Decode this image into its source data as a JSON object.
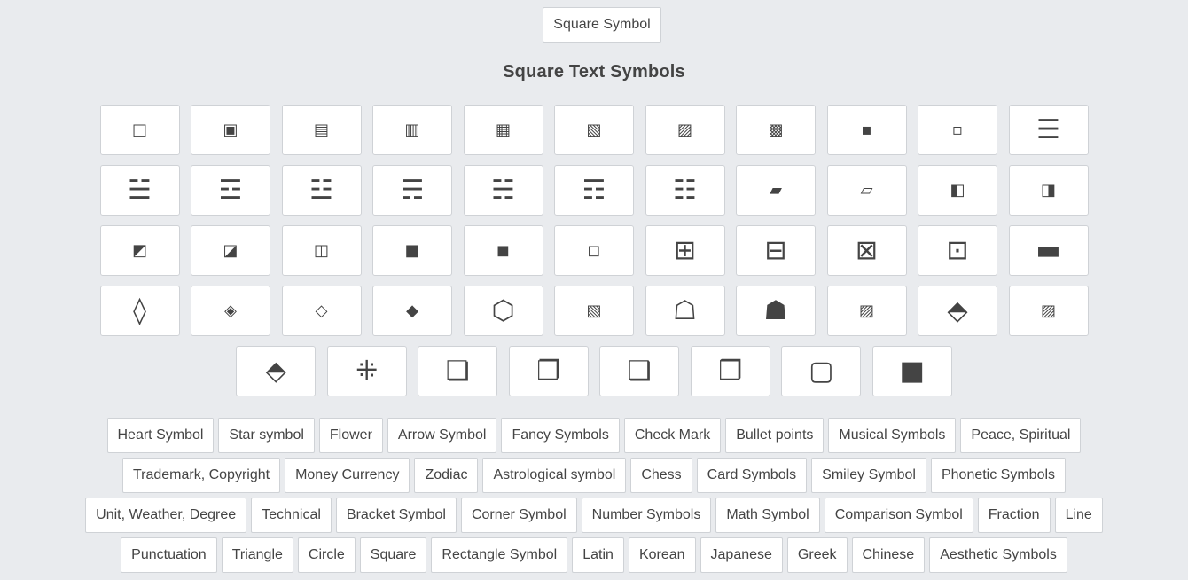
{
  "top_button": "Square Symbol",
  "heading": "Square Text Symbols",
  "symbol_rows": [
    [
      "□",
      "▣",
      "▤",
      "▥",
      "▦",
      "▧",
      "▨",
      "▩",
      "▪",
      "▫",
      "☰"
    ],
    [
      "☱",
      "☲",
      "☳",
      "☴",
      "☵",
      "☶",
      "☷",
      "▰",
      "▱",
      "◧",
      "◨"
    ],
    [
      "◩",
      "◪",
      "◫",
      "■",
      "◼",
      "◻",
      "⊞",
      "⊟",
      "⊠",
      "⊡",
      "▬"
    ],
    [
      "◊",
      "◈",
      "◇",
      "◆",
      "⬡",
      "▧",
      "☖",
      "☗",
      "▨",
      "⬘",
      "▨"
    ],
    [
      "⬘",
      "⁜",
      "❏",
      "❐",
      "❑",
      "❒",
      "▢",
      "■"
    ]
  ],
  "link_rows": [
    [
      "Heart Symbol",
      "Star symbol",
      "Flower",
      "Arrow Symbol",
      "Fancy Symbols",
      "Check Mark",
      "Bullet points",
      "Musical Symbols",
      "Peace, Spiritual"
    ],
    [
      "Trademark, Copyright",
      "Money Currency",
      "Zodiac",
      "Astrological symbol",
      "Chess",
      "Card Symbols",
      "Smiley Symbol",
      "Phonetic Symbols"
    ],
    [
      "Unit, Weather, Degree",
      "Technical",
      "Bracket Symbol",
      "Corner Symbol",
      "Number Symbols",
      "Math Symbol",
      "Comparison Symbol",
      "Fraction",
      "Line"
    ],
    [
      "Punctuation",
      "Triangle",
      "Circle",
      "Square",
      "Rectangle Symbol",
      "Latin",
      "Korean",
      "Japanese",
      "Greek",
      "Chinese",
      "Aesthetic Symbols"
    ]
  ]
}
